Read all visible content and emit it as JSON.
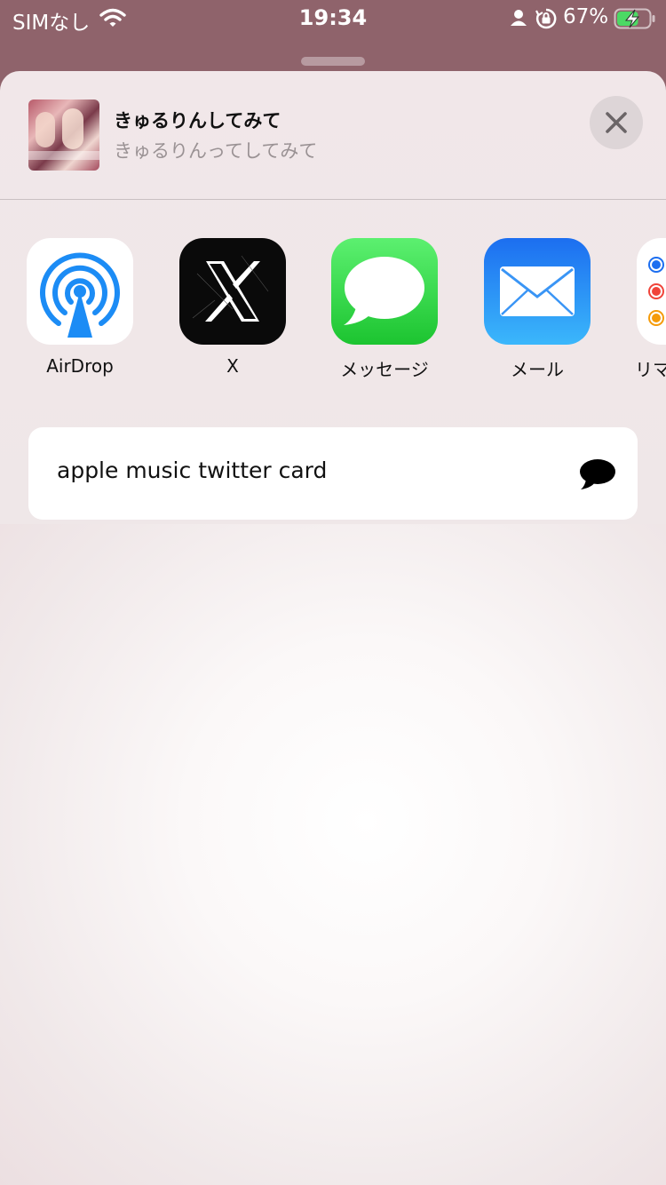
{
  "status_bar": {
    "carrier": "SIMなし",
    "time": "19:34",
    "battery_percent": "67%",
    "battery_level": 0.67,
    "icons": [
      "wifi-icon",
      "person-icon",
      "rotation-lock-icon",
      "battery-charging-icon"
    ]
  },
  "share_header": {
    "title": "きゅるりんしてみて",
    "subtitle": "きゅるりんってしてみて",
    "close_icon": "close-icon"
  },
  "apps": [
    {
      "label": "AirDrop",
      "icon": "airdrop-icon"
    },
    {
      "label": "X",
      "icon": "x-logo-icon"
    },
    {
      "label": "メッセージ",
      "icon": "messages-icon"
    },
    {
      "label": "メール",
      "icon": "mail-icon"
    },
    {
      "label": "リマ",
      "icon": "reminders-icon"
    }
  ],
  "action": {
    "label": "apple music twitter card",
    "icon": "speech-bubble-icon"
  },
  "colors": {
    "background": "#8f636b",
    "sheet": "#f1e7e9",
    "airdrop_blue": "#1c8cf5",
    "messages_green": "#2fd045",
    "mail_blue": "#2a8ef7"
  }
}
